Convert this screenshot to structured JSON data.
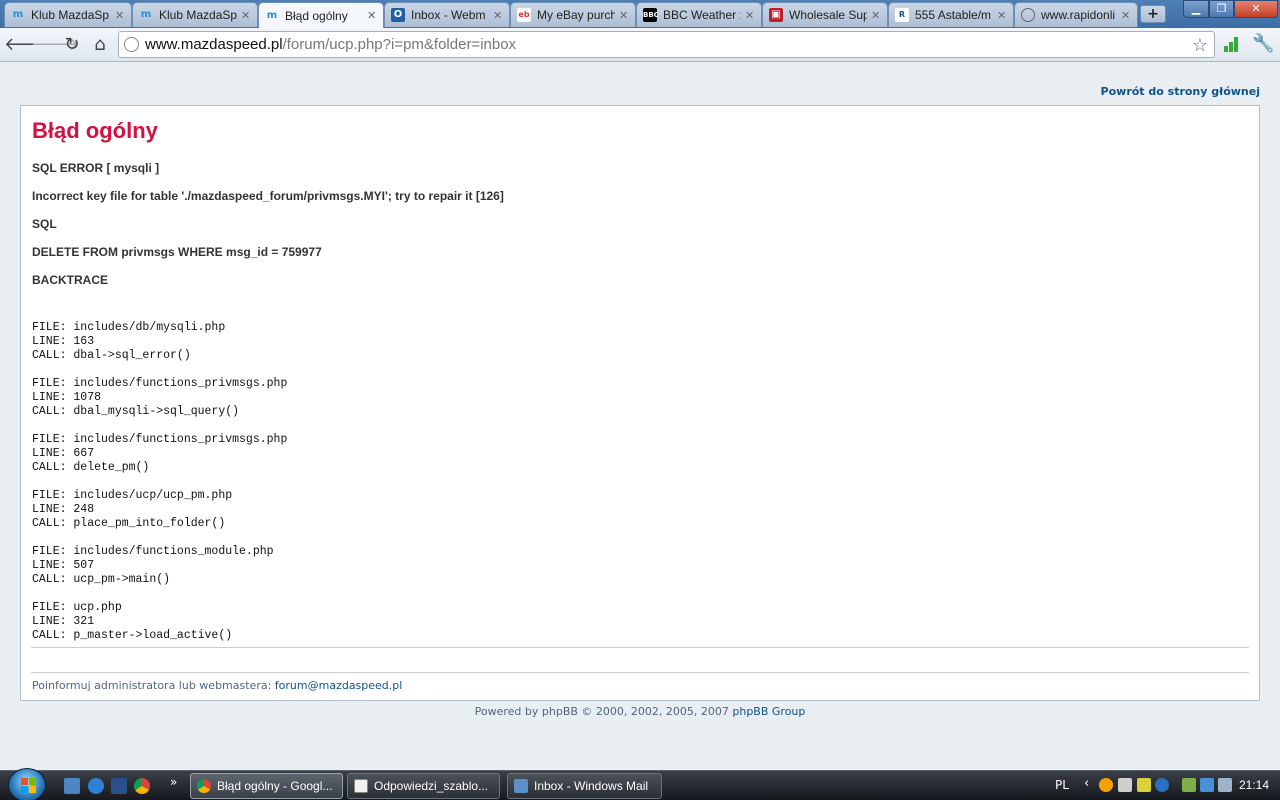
{
  "browser": {
    "tabs": [
      {
        "title": "Klub MazdaSp",
        "icon": "mazda-icon",
        "active": false
      },
      {
        "title": "Klub MazdaSp",
        "icon": "mazda-icon",
        "active": false
      },
      {
        "title": "Błąd ogólny",
        "icon": "mazda-icon",
        "active": true
      },
      {
        "title": "Inbox - Webm",
        "icon": "outlook-icon",
        "active": false
      },
      {
        "title": "My eBay purch",
        "icon": "ebay-icon",
        "active": false
      },
      {
        "title": "BBC Weather :",
        "icon": "bbc-icon",
        "active": false
      },
      {
        "title": "Wholesale Sup",
        "icon": "cart-icon",
        "active": false
      },
      {
        "title": "555 Astable/m",
        "icon": "site-icon",
        "active": false
      },
      {
        "title": "www.rapidonli",
        "icon": "globe-icon",
        "active": false
      }
    ],
    "new_tab_label": "+",
    "url_host": "www.mazdaspeed.pl",
    "url_path": "/forum/ucp.php?i=pm&folder=inbox"
  },
  "page": {
    "back_link": "Powrót do strony głównej",
    "title": "Błąd ogólny",
    "error_type": "SQL ERROR [ mysqli ]",
    "error_message": "Incorrect key file for table './mazdaspeed_forum/privmsgs.MYI'; try to repair it [126]",
    "sql_heading": "SQL",
    "sql_query": "DELETE FROM privmsgs WHERE msg_id = 759977",
    "backtrace_heading": "BACKTRACE",
    "backtrace": [
      {
        "file": "FILE: includes/db/mysqli.php",
        "line": "LINE: 163",
        "call": "CALL: dbal->sql_error()"
      },
      {
        "file": "FILE: includes/functions_privmsgs.php",
        "line": "LINE: 1078",
        "call": "CALL: dbal_mysqli->sql_query()"
      },
      {
        "file": "FILE: includes/functions_privmsgs.php",
        "line": "LINE: 667",
        "call": "CALL: delete_pm()"
      },
      {
        "file": "FILE: includes/ucp/ucp_pm.php",
        "line": "LINE: 248",
        "call": "CALL: place_pm_into_folder()"
      },
      {
        "file": "FILE: includes/functions_module.php",
        "line": "LINE: 507",
        "call": "CALL: ucp_pm->main()"
      },
      {
        "file": "FILE: ucp.php",
        "line": "LINE: 321",
        "call": "CALL: p_master->load_active()"
      }
    ],
    "notify_text": "Poinformuj administratora lub webmastera:",
    "notify_email": "forum@mazdaspeed.pl",
    "powered_prefix": "Powered by phpBB © 2000, 2002, 2005, 2007",
    "powered_link": "phpBB Group"
  },
  "taskbar": {
    "buttons": [
      {
        "label": "Błąd ogólny - Googl...",
        "icon": "chrome-icon",
        "active": true
      },
      {
        "label": "Odpowiedzi_szablo...",
        "icon": "document-icon",
        "active": false
      },
      {
        "label": "Inbox - Windows Mail",
        "icon": "mail-icon",
        "active": false
      }
    ],
    "language": "PL",
    "clock": "21:14"
  },
  "colors": {
    "error_title": "#d31141",
    "link": "#105289",
    "page_background": "#e9eef2"
  }
}
